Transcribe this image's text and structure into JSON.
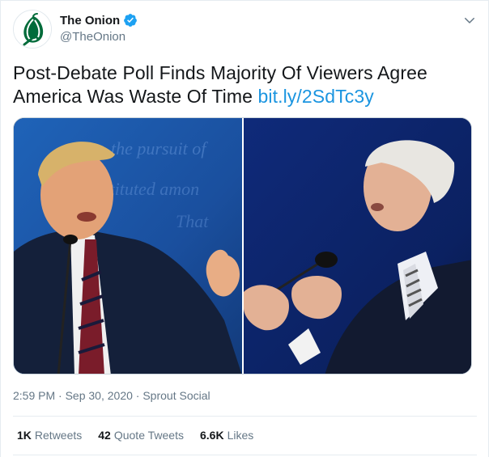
{
  "account": {
    "display_name": "The Onion",
    "handle": "@TheOnion",
    "verified": true
  },
  "icons": {
    "avatar": "onion-logo-icon",
    "verified": "verified-badge-icon",
    "menu": "chevron-down-icon"
  },
  "tweet": {
    "text": "Post-Debate Poll Finds Majority Of Viewers Agree America Was Waste Of Time",
    "link": "bit.ly/2SdTc3y"
  },
  "meta": {
    "time": "2:59 PM",
    "sep1": "·",
    "date": "Sep 30, 2020",
    "sep2": "·",
    "source": "Sprout Social"
  },
  "stats": {
    "retweets": {
      "count": "1K",
      "label": "Retweets"
    },
    "quotes": {
      "count": "42",
      "label": "Quote Tweets"
    },
    "likes": {
      "count": "6.6K",
      "label": "Likes"
    }
  },
  "colors": {
    "link": "#1b95e0",
    "verified": "#1da1f2",
    "brand_green": "#006b3a",
    "secondary_text": "#657786"
  }
}
